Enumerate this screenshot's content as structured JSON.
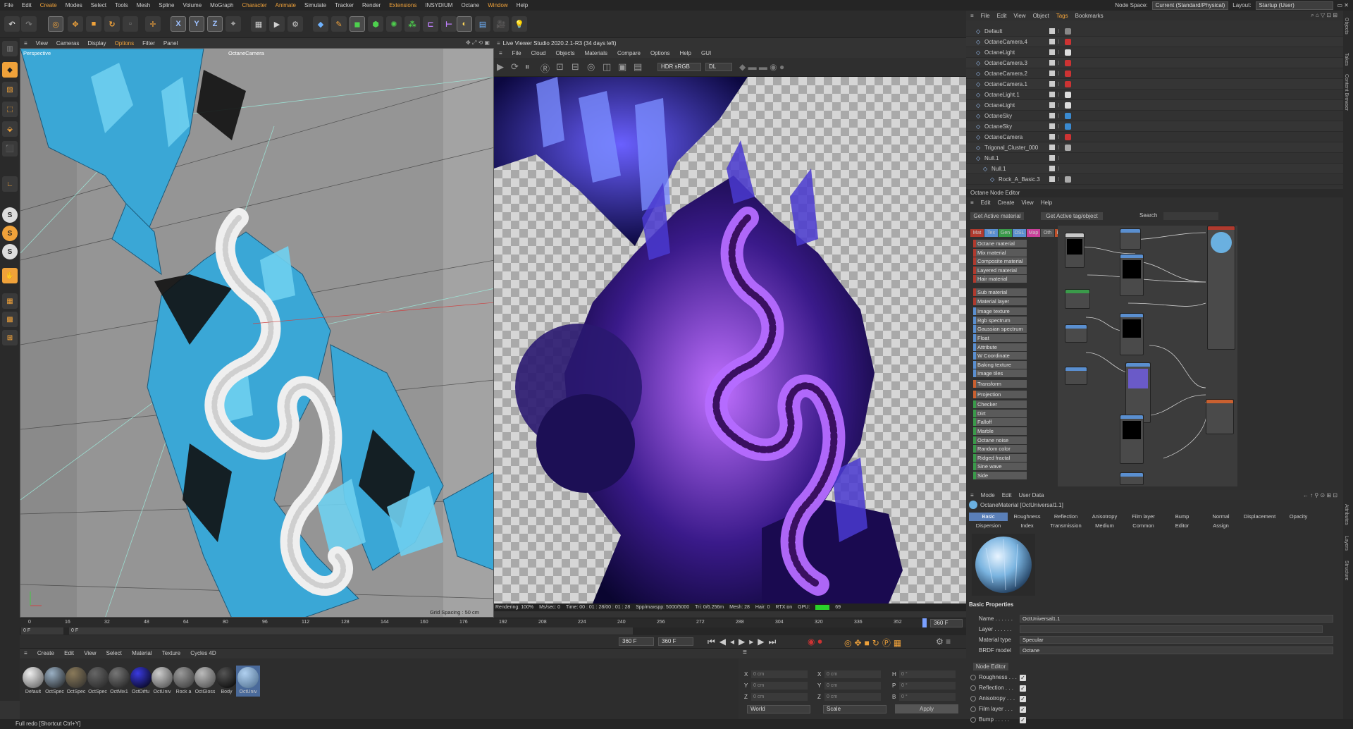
{
  "menubar": {
    "items": [
      "File",
      "Edit",
      "Create",
      "Modes",
      "Select",
      "Tools",
      "Mesh",
      "Spline",
      "Volume",
      "MoGraph",
      "Character",
      "Animate",
      "Simulate",
      "Tracker",
      "Render",
      "Extensions",
      "INSYDIUM",
      "Octane",
      "Window",
      "Help"
    ],
    "node_space_label": "Node Space:",
    "node_space_value": "Current (Standard/Physical)",
    "layout_label": "Layout:",
    "layout_value": "Startup (User)"
  },
  "viewport": {
    "menu": [
      "View",
      "Cameras",
      "Display",
      "Options",
      "Filter",
      "Panel"
    ],
    "mode_label": "Perspective",
    "camera_label": "OctaneCamera",
    "grid_spacing": "Grid Spacing : 50 cm"
  },
  "liveviewer": {
    "title": "Live Viewer Studio 2020.2.1-R3 (34 days left)",
    "menu": [
      "File",
      "Cloud",
      "Objects",
      "Materials",
      "Compare",
      "Options",
      "Help",
      "GUI"
    ],
    "color_space": "HDR sRGB",
    "mode": "DL",
    "status": {
      "rendering": "Rendering: 100%",
      "ms": "Ms/sec: 0",
      "time": "Time: 00 : 01 : 28/00 : 01 : 28",
      "spp": "Spp/maxspp: 5000/5000",
      "tri": "Tri: 0/6.256m",
      "mesh": "Mesh: 28",
      "hair": "Hair: 0",
      "rtx": "RTX:on",
      "gpu": "GPU:",
      "gpu_val": "69"
    }
  },
  "timeline": {
    "ticks": [
      "0",
      "16",
      "32",
      "48",
      "64",
      "80",
      "96",
      "112",
      "128",
      "144",
      "160",
      "176",
      "192",
      "208",
      "224",
      "240",
      "256",
      "272",
      "288",
      "304",
      "320",
      "336",
      "352"
    ],
    "end_frame": "360 F",
    "current": "0 F",
    "current2": "0 F",
    "range_end": "360 F",
    "range_end2": "360 F"
  },
  "materials": {
    "menu": [
      "Create",
      "Edit",
      "View",
      "Select",
      "Material",
      "Texture",
      "Cycles 4D"
    ],
    "items": [
      {
        "label": "Default",
        "c1": "#eeeeee",
        "c2": "#555555"
      },
      {
        "label": "OctSpec",
        "c1": "#9ab0c4",
        "c2": "#1a1a1a"
      },
      {
        "label": "OctSpec",
        "c1": "#8a7a5a",
        "c2": "#2a2a2a"
      },
      {
        "label": "OctSpec",
        "c1": "#666666",
        "c2": "#222222"
      },
      {
        "label": "OctMix1",
        "c1": "#777777",
        "c2": "#1a1a1a"
      },
      {
        "label": "OctDiffu",
        "c1": "#3a3ae0",
        "c2": "#000000"
      },
      {
        "label": "OctUniv",
        "c1": "#cccccc",
        "c2": "#444444"
      },
      {
        "label": "Rock a",
        "c1": "#9a9a9a",
        "c2": "#333333"
      },
      {
        "label": "OctGloss",
        "c1": "#bbbbbb",
        "c2": "#444444"
      },
      {
        "label": "Body",
        "c1": "#555555",
        "c2": "#000000"
      },
      {
        "label": "OctUniv",
        "c1": "#b0d0f0",
        "c2": "#4a6a8a"
      }
    ]
  },
  "coords": {
    "rows": [
      {
        "a": "X",
        "av": "0 cm",
        "b": "X",
        "bv": "0 cm",
        "c": "H",
        "cv": "0 °"
      },
      {
        "a": "Y",
        "av": "0 cm",
        "b": "Y",
        "bv": "0 cm",
        "c": "P",
        "cv": "0 °"
      },
      {
        "a": "Z",
        "av": "0 cm",
        "b": "Z",
        "bv": "0 cm",
        "c": "B",
        "cv": "0 °"
      }
    ],
    "world": "World",
    "scale": "Scale",
    "apply": "Apply"
  },
  "statusbar": {
    "text": "Full redo [Shortcut Ctrl+Y]"
  },
  "objects": {
    "menu": [
      "File",
      "Edit",
      "View",
      "Object",
      "Tags",
      "Bookmarks"
    ],
    "rows": [
      "Default",
      "OctaneCamera.4",
      "OctaneLight",
      "OctaneCamera.3",
      "OctaneCamera.2",
      "OctaneCamera.1",
      "OctaneLight.1",
      "OctaneLight",
      "OctaneSky",
      "OctaneSky",
      "OctaneCamera",
      "Trigonal_Cluster_000",
      "Null.1",
      "Null.1",
      "Rock_A_Basic.3"
    ]
  },
  "nodeeditor": {
    "title": "Octane Node Editor",
    "menu": [
      "Edit",
      "Create",
      "View",
      "Help"
    ],
    "btn_material": "Get Active material",
    "btn_tag": "Get Active tag/object",
    "search": "Search",
    "cats": [
      "Mat",
      "Tex",
      "Gen",
      "OSL",
      "Map",
      "Oth",
      "Ems",
      "Med",
      "Um",
      "C4D"
    ],
    "list": [
      "Octane material",
      "Mix material",
      "Composite material",
      "Layered material",
      "Hair material",
      "Sub material",
      "Material layer",
      "Image texture",
      "Rgb spectrum",
      "Gaussian spectrum",
      "Float",
      "Attribute",
      "W Coordinate",
      "Baking texture",
      "Image tiles",
      "Transform",
      "Projection",
      "Checker",
      "Dirt",
      "Falloff",
      "Marble",
      "Octane noise",
      "Random color",
      "Ridged fractal",
      "Sine wave",
      "Side"
    ]
  },
  "attributes": {
    "menu": [
      "Mode",
      "Edit",
      "User Data"
    ],
    "object": "OctaneMaterial [OctUniversal1.1]",
    "tabs1": [
      "Basic",
      "Roughness",
      "Reflection",
      "Anisotropy",
      "Film layer",
      "Bump",
      "Normal",
      "Displacement",
      "Opacity"
    ],
    "tabs2": [
      "Dispersion",
      "Index",
      "Transmission",
      "Medium",
      "Common",
      "Editor",
      "Assign"
    ],
    "section": "Basic Properties",
    "name_label": "Name . . . . . .",
    "name_value": "OctUniversal1.1",
    "layer_label": "Layer . . . . . .",
    "mtype_label": "Material type",
    "mtype_value": "Specular",
    "brdf_label": "BRDF model",
    "brdf_value": "Octane",
    "node_editor_btn": "Node Editor",
    "checks": [
      "Roughness . . .",
      "Reflection . . .",
      "Anisotropy . . .",
      "Film layer . . .",
      "Bump . . . . ."
    ]
  },
  "side_tabs": [
    "Objects",
    "Takes",
    "Content Browser",
    "Attributes",
    "Layers",
    "Structure"
  ]
}
